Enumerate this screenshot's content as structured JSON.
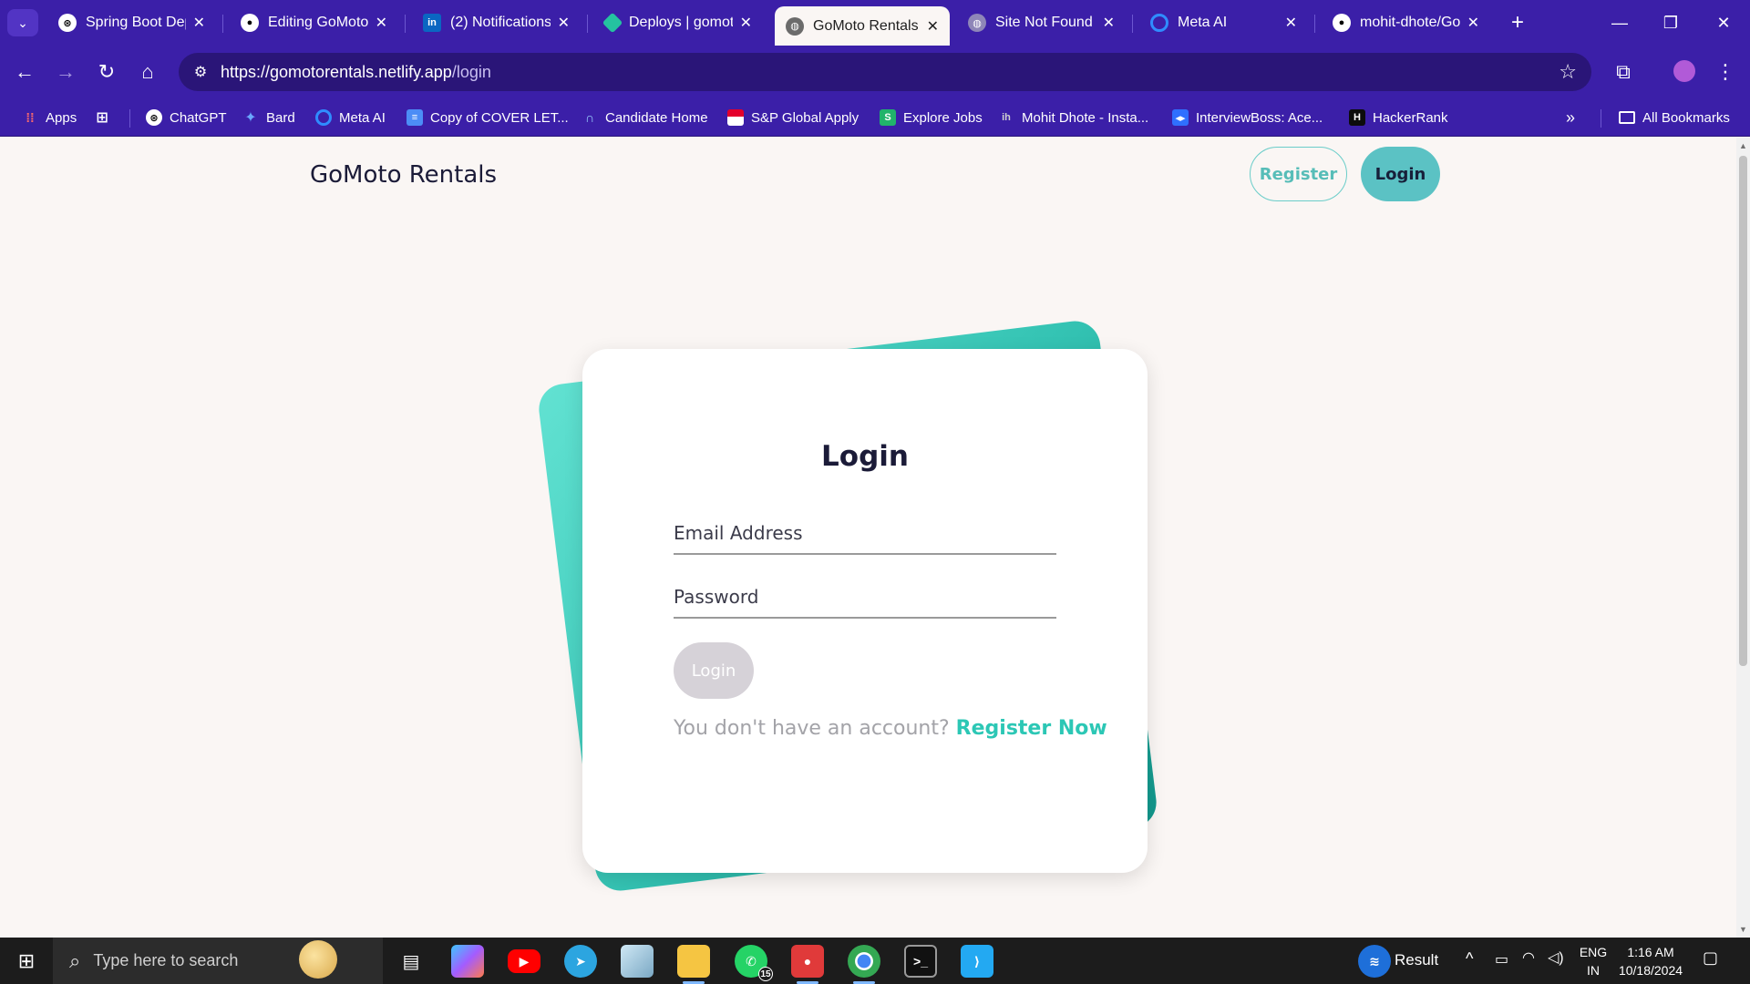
{
  "browser": {
    "tabs": [
      {
        "title": "Spring Boot Dep",
        "icon": "openai-icon",
        "active": false
      },
      {
        "title": "Editing GoMoto-",
        "icon": "github-icon",
        "active": false
      },
      {
        "title": "(2) Notifications |",
        "icon": "linkedin-icon",
        "active": false
      },
      {
        "title": "Deploys | gomot",
        "icon": "netlify-icon",
        "active": false
      },
      {
        "title": "GoMoto Rentals",
        "icon": "globe-icon",
        "active": true
      },
      {
        "title": "Site Not Found",
        "icon": "globe-icon",
        "active": false
      },
      {
        "title": "Meta AI",
        "icon": "meta-ai-icon",
        "active": false
      },
      {
        "title": "mohit-dhote/Go",
        "icon": "github-icon",
        "active": false
      }
    ],
    "url_host": "https://gomotorentals.netlify.app",
    "url_path": "/login",
    "bookmarks": [
      {
        "label": "Apps",
        "icon": "apps-grid-icon"
      },
      {
        "label": "ChatGPT",
        "icon": "openai-icon"
      },
      {
        "label": "Bard",
        "icon": "sparkle-icon"
      },
      {
        "label": "Meta AI",
        "icon": "meta-ai-icon"
      },
      {
        "label": "Copy of COVER LET...",
        "icon": "docs-icon"
      },
      {
        "label": "Candidate Home",
        "icon": "candidate-icon"
      },
      {
        "label": "S&P Global Apply",
        "icon": "sp-global-icon"
      },
      {
        "label": "Explore Jobs",
        "icon": "explore-jobs-icon"
      },
      {
        "label": "Mohit Dhote - Insta...",
        "icon": "instahyre-icon"
      },
      {
        "label": "InterviewBoss: Ace...",
        "icon": "interviewboss-icon"
      },
      {
        "label": "HackerRank",
        "icon": "hackerrank-icon"
      }
    ],
    "all_bookmarks": "All Bookmarks"
  },
  "page": {
    "brand": "GoMoto Rentals",
    "nav": {
      "register": "Register",
      "login": "Login"
    },
    "card": {
      "title": "Login",
      "email_placeholder": "Email Address",
      "password_placeholder": "Password",
      "submit": "Login",
      "prompt": "You don't have an account?",
      "register_link": "Register Now"
    }
  },
  "taskbar": {
    "search_placeholder": "Type here to search",
    "weather": "Result",
    "whatsapp_badge": "15",
    "lang_top": "ENG",
    "lang_bottom": "IN",
    "time": "1:16 AM",
    "date": "10/18/2024"
  },
  "colors": {
    "chrome": "#3b1fa8",
    "teal_accent": "#2cc7b5",
    "login_button": "#5bc2c4",
    "page_bg": "#faf6f4"
  }
}
